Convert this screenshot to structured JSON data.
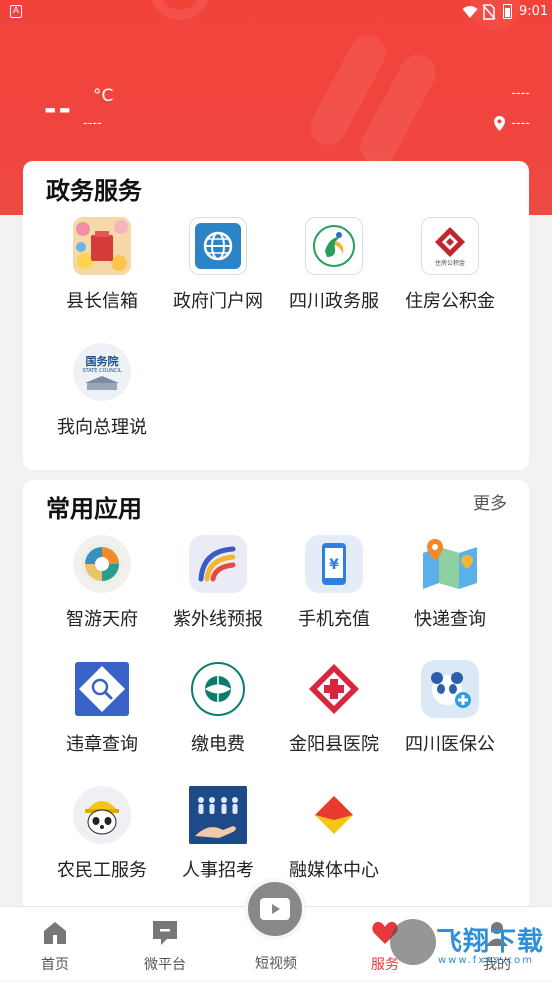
{
  "status_bar": {
    "time": "9:01",
    "app_badge": "A"
  },
  "weather": {
    "temperature": "--",
    "unit": "°C",
    "description": "----",
    "right_top": "----",
    "location": "----"
  },
  "gov_services": {
    "title": "政务服务",
    "items": [
      {
        "label": "县长信箱",
        "icon": "mailbox-icon"
      },
      {
        "label": "政府门户网",
        "icon": "globe-icon"
      },
      {
        "label": "四川政务服",
        "icon": "sichuan-gov-icon"
      },
      {
        "label": "住房公积金",
        "icon": "housing-fund-icon"
      },
      {
        "label": "我向总理说",
        "icon": "state-council-icon"
      }
    ],
    "state_council_logo_text": "国务院",
    "state_council_logo_sub": "STATE COUNCIL",
    "housing_logo_text": "住房公积金"
  },
  "common_apps": {
    "title": "常用应用",
    "more": "更多",
    "items": [
      {
        "label": "智游天府",
        "icon": "travel-icon"
      },
      {
        "label": "紫外线预报",
        "icon": "uv-icon"
      },
      {
        "label": "手机充值",
        "icon": "phone-recharge-icon"
      },
      {
        "label": "快递查询",
        "icon": "express-map-icon"
      },
      {
        "label": "违章查询",
        "icon": "violation-search-icon"
      },
      {
        "label": "缴电费",
        "icon": "state-grid-icon"
      },
      {
        "label": "金阳县医院",
        "icon": "hospital-icon"
      },
      {
        "label": "四川医保公",
        "icon": "medical-insurance-icon"
      },
      {
        "label": "农民工服务",
        "icon": "worker-panda-icon"
      },
      {
        "label": "人事招考",
        "icon": "recruitment-icon"
      },
      {
        "label": "融媒体中心",
        "icon": "media-center-icon"
      }
    ]
  },
  "nav": {
    "items": [
      {
        "label": "首页",
        "icon": "home-icon"
      },
      {
        "label": "微平台",
        "icon": "chat-icon"
      },
      {
        "label": "短视频",
        "icon": "video-icon"
      },
      {
        "label": "服务",
        "icon": "heart-icon",
        "active": true
      },
      {
        "label": "我的",
        "icon": "user-icon"
      }
    ]
  },
  "watermark": {
    "text": "飞翔下载",
    "sub": "www.fxxz.com"
  },
  "colors": {
    "header_red": "#f2433b",
    "active_red": "#e8383d",
    "watermark_blue": "#2f8fd8"
  }
}
